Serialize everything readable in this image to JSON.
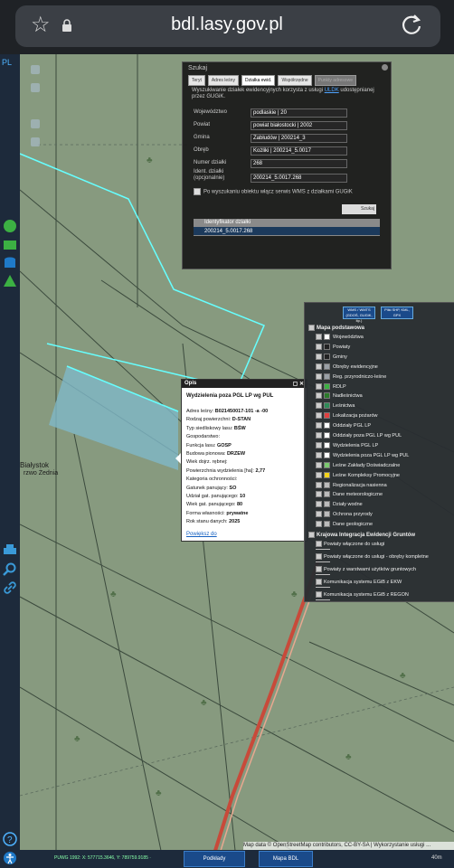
{
  "browser": {
    "url": "bdl.lasy.gov.pl"
  },
  "lang": "PL",
  "search_panel": {
    "title": "Szukaj",
    "tabs": [
      "Teryt",
      "Adres leśny",
      "Działka ewid.",
      "Współrzędne",
      "Punkty adresowe"
    ],
    "info_text": "Wyszukiwanie działek ewidencyjnych korzysta z usługi",
    "info_link": "ULDK",
    "info_text2": "udostępnianej przez GUGiK.",
    "fields": [
      {
        "label": "Województwo",
        "value": "podlaskie | 20"
      },
      {
        "label": "Powiat",
        "value": "powiat białostocki | 2002"
      },
      {
        "label": "Gmina",
        "value": "Zabłudów | 200214_3"
      },
      {
        "label": "Obręb",
        "value": "Kożliki | 200214_5.0017"
      },
      {
        "label": "Numer działki",
        "value": "268"
      },
      {
        "label": "Ident. działki (opcjonalnie)",
        "value": "200214_5.0017.268"
      }
    ],
    "checkbox_label": "Po wyszukaniu obiektu włącz serwis WMS z działkami GUGiK",
    "search_button": "Szukaj",
    "result_header": "Identyfikator działki",
    "result_value": "200214_5.0017.268"
  },
  "opis_panel": {
    "header": "Opis",
    "title": "Wydzielenia poza PGL LP wg PUL",
    "rows": [
      {
        "label": "Adres leśny:",
        "value": "B021450017-101 -a -00"
      },
      {
        "label": "Rodzaj powierzchni:",
        "value": "D-STAN"
      },
      {
        "label": "Typ siedliskowy lasu:",
        "value": "BŚW"
      },
      {
        "label": "Gospodarstwo:",
        "value": ""
      },
      {
        "label": "Funkcja lasu:",
        "value": "GOSP"
      },
      {
        "label": "Budowa pionowa:",
        "value": "DRZEW"
      },
      {
        "label": "Wiek dojrz. rębnej:",
        "value": ""
      },
      {
        "label": "Powierzchnia wydzielenia [ha]:",
        "value": "2,77"
      },
      {
        "label": "Kategoria ochronności:",
        "value": ""
      },
      {
        "label": "Gatunek panujący:",
        "value": "SO"
      },
      {
        "label": "Udział gat. panującego:",
        "value": "10"
      },
      {
        "label": "Wiek gat. panującego:",
        "value": "80"
      },
      {
        "label": "Forma własności:",
        "value": "prywatne"
      },
      {
        "label": "Rok stanu danych:",
        "value": "2025"
      }
    ],
    "link": "Powiększ do"
  },
  "layers_panel": {
    "buttons": [
      "WMS / WMTS (GDOŚ, GUGiK, itp.)",
      "Pliki SHP, KML, GPX"
    ],
    "group1": "Mapa podstawowa",
    "layers1": [
      {
        "label": "Województwa",
        "color": "#ffffff"
      },
      {
        "label": "Powiaty",
        "color": "#222222"
      },
      {
        "label": "Gminy",
        "color": "#222222"
      },
      {
        "label": "Obręby ewidencyjne",
        "color": "#9aa0a6"
      },
      {
        "label": "Reg. przyrodniczo-leśne",
        "color": "#9aa0a6"
      },
      {
        "label": "RDLP",
        "color": "#3cb043"
      },
      {
        "label": "Nadleśnictwa",
        "color": "#2a7a2a"
      },
      {
        "label": "Leśnictwa",
        "color": "#2e8b57"
      },
      {
        "label": "Lokalizacja pożarów",
        "color": "#e04040"
      },
      {
        "label": "Oddziały PGL LP",
        "color": "#ffffff"
      },
      {
        "label": "Oddziały poza PGL LP wg PUL",
        "color": "#ffffff"
      },
      {
        "label": "Wydzielenia PGL LP",
        "color": "#ffffff"
      },
      {
        "label": "Wydzielenia poza PGL LP wg PUL",
        "color": "#ffffff"
      },
      {
        "label": "Leśne Zakłady Doświadczalne",
        "color": "#7bc96f"
      },
      {
        "label": "Leśne Kompleksy Promocyjne",
        "color": "#f2d21b"
      },
      {
        "label": "Regionalizacja nasienna",
        "color": "#bbbbbb"
      },
      {
        "label": "Dane meteorologiczne",
        "color": "#bbbbbb"
      },
      {
        "label": "Działy wodne",
        "color": "#bbbbbb"
      },
      {
        "label": "Ochrona przyrody",
        "color": "#bbbbbb"
      },
      {
        "label": "Dane geologiczne",
        "color": "#bbbbbb"
      }
    ],
    "group2": "Krajowa Integracja Ewidencji Gruntów",
    "layers2": [
      "Powiaty włączone do usługi",
      "Powiaty włączone do usługi - obręby kompletne",
      "Powiaty z warstwami użytków gruntowych",
      "Komunikacja systemu EGiB z EKW",
      "Komunikacja systemu EGiB z REGON"
    ]
  },
  "map": {
    "place_label": "Białystok",
    "place_label2": "rzwo Żednia",
    "attribution": "Map data © OpenStreetMap contributors, CC-BY-SA | Wykorzystanie usługi ...",
    "coords": "PUWG 1992: X: 577715.3646, Y: 789759.9185 ·",
    "scale": "40m",
    "bottom_buttons": [
      "Podkłady",
      "Mapa BDL"
    ]
  }
}
